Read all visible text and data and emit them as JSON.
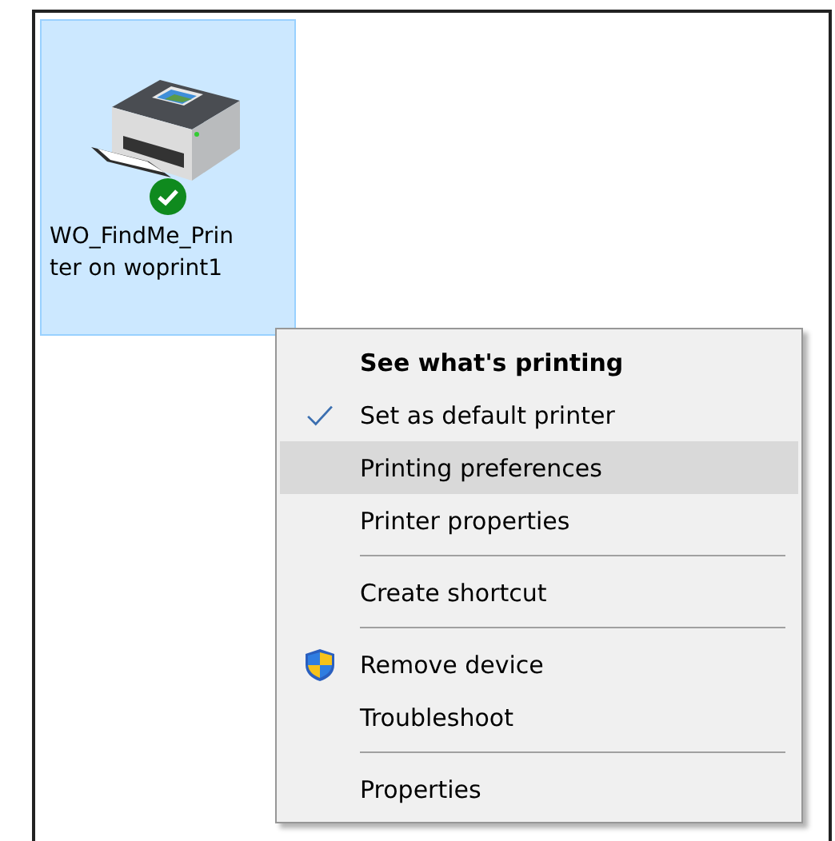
{
  "device": {
    "label_lines": [
      "WO_FindMe_Prin",
      "ter on woprint1"
    ],
    "selected": true,
    "default": true
  },
  "context_menu": {
    "items": [
      {
        "kind": "item",
        "label": "See what's printing",
        "bold": true,
        "checked": false,
        "selected": false,
        "shield": false
      },
      {
        "kind": "item",
        "label": "Set as default printer",
        "bold": false,
        "checked": true,
        "selected": false,
        "shield": false
      },
      {
        "kind": "item",
        "label": "Printing preferences",
        "bold": false,
        "checked": false,
        "selected": true,
        "shield": false
      },
      {
        "kind": "item",
        "label": "Printer properties",
        "bold": false,
        "checked": false,
        "selected": false,
        "shield": false
      },
      {
        "kind": "separator"
      },
      {
        "kind": "item",
        "label": "Create shortcut",
        "bold": false,
        "checked": false,
        "selected": false,
        "shield": false
      },
      {
        "kind": "separator"
      },
      {
        "kind": "item",
        "label": "Remove device",
        "bold": false,
        "checked": false,
        "selected": false,
        "shield": true
      },
      {
        "kind": "item",
        "label": "Troubleshoot",
        "bold": false,
        "checked": false,
        "selected": false,
        "shield": false
      },
      {
        "kind": "separator"
      },
      {
        "kind": "item",
        "label": "Properties",
        "bold": false,
        "checked": false,
        "selected": false,
        "shield": false
      }
    ]
  }
}
